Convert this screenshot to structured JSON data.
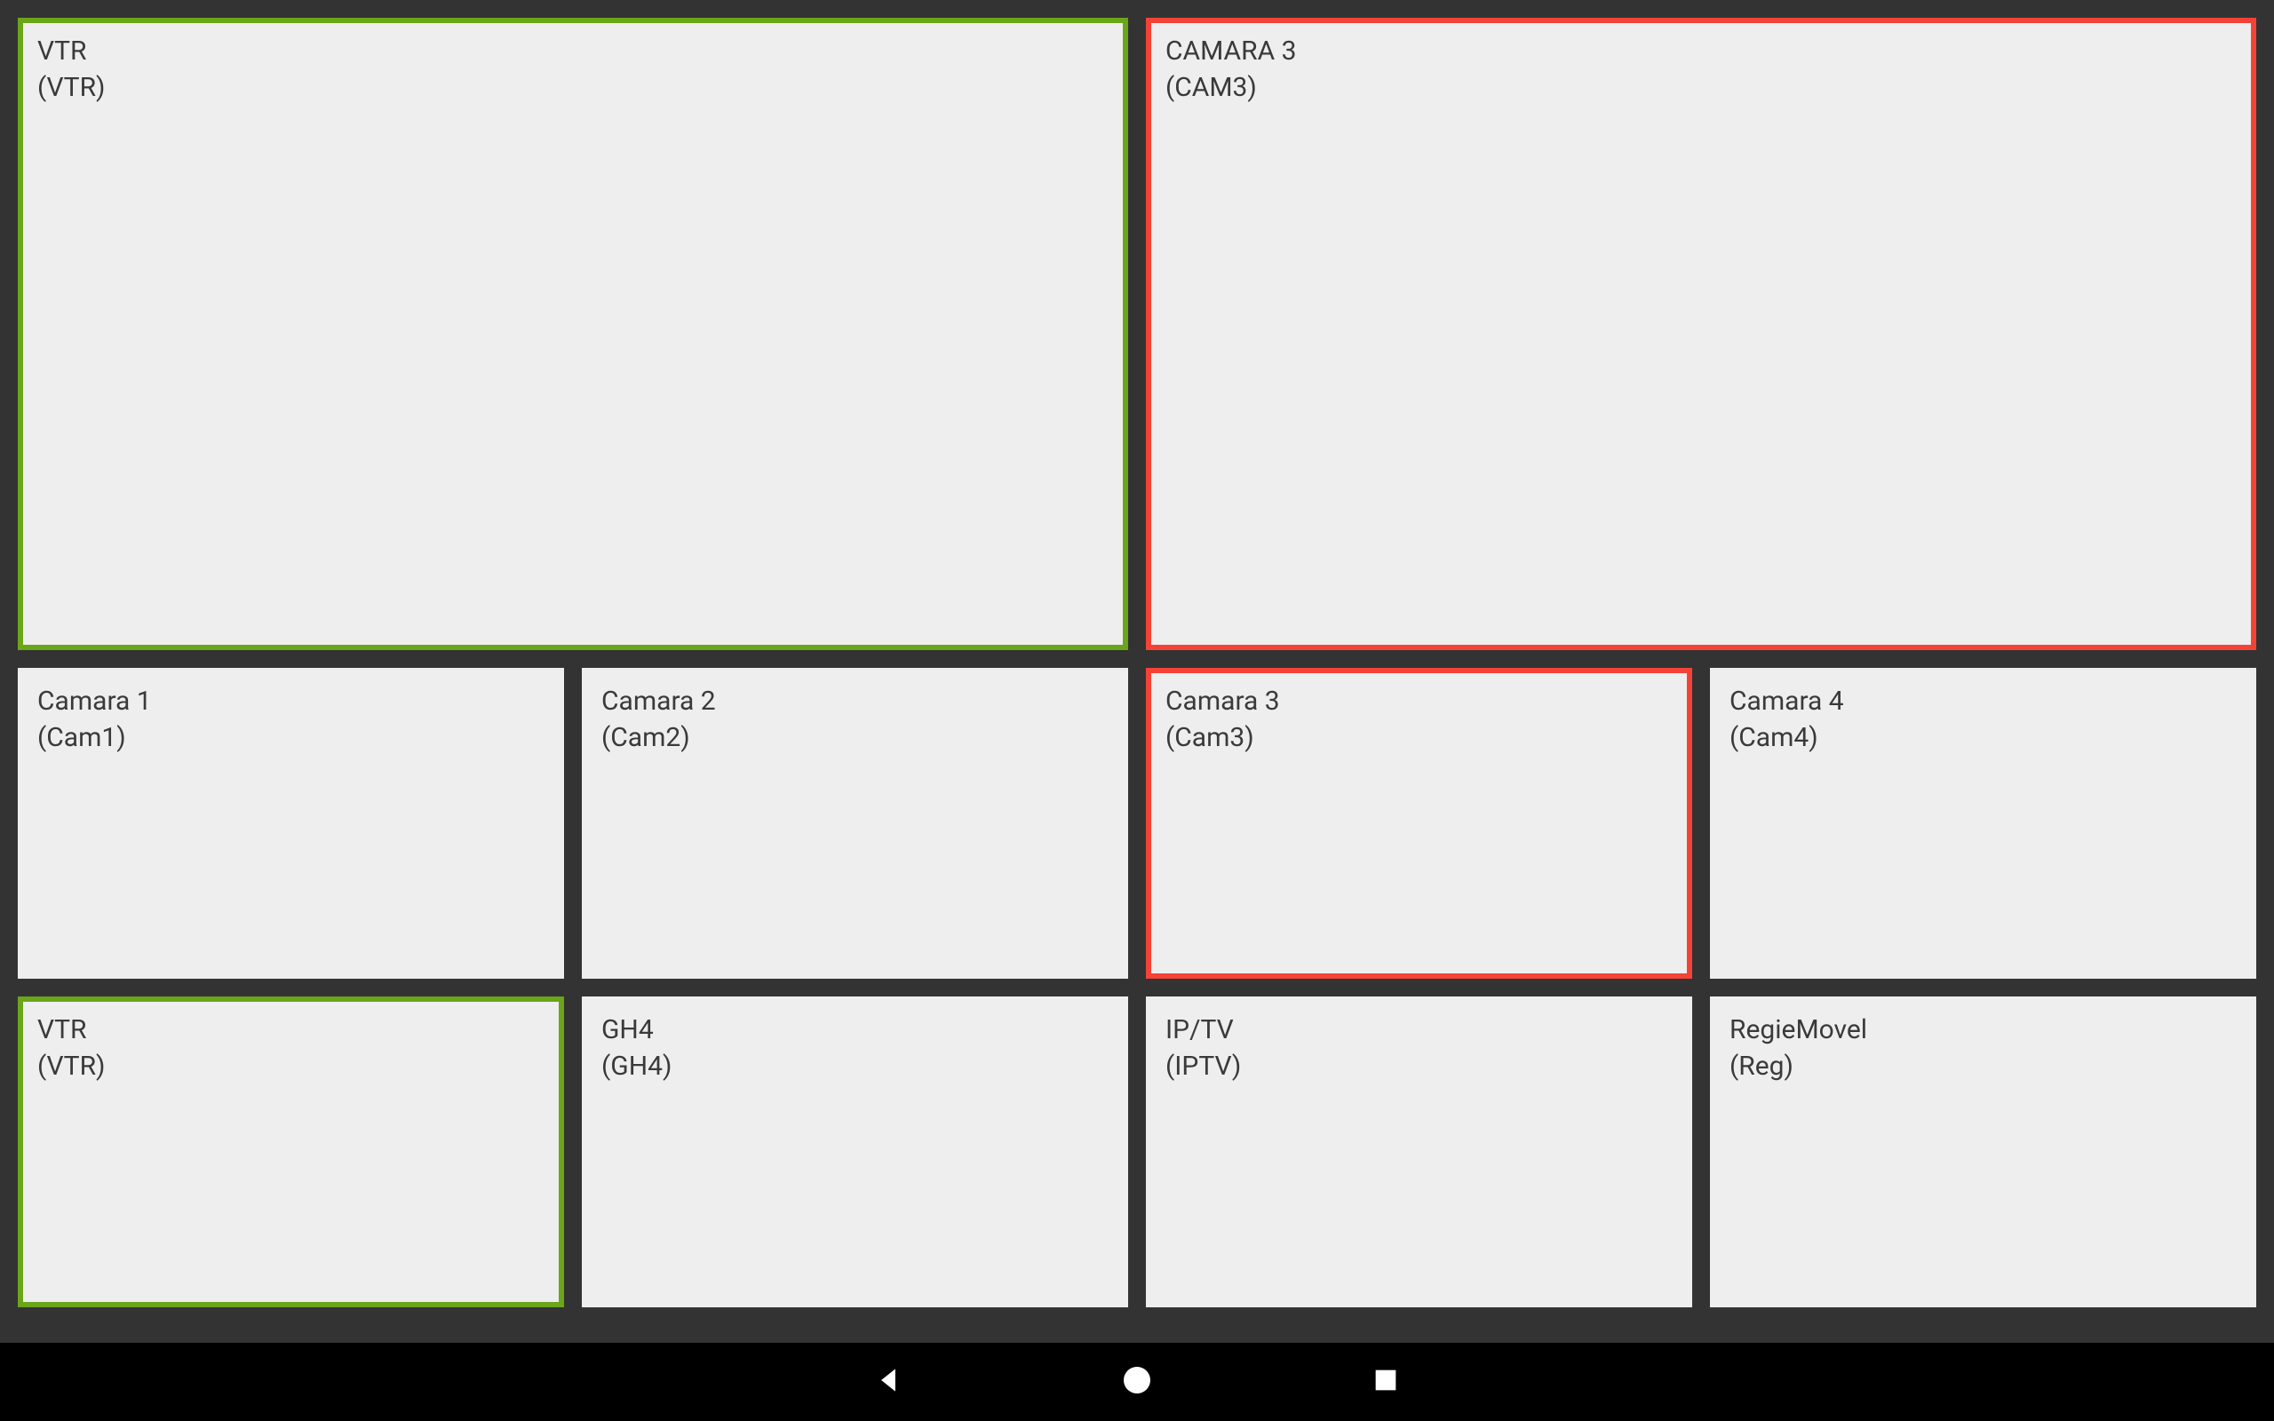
{
  "colors": {
    "background": "#333333",
    "panel": "#EEEEEE",
    "borderGreen": "#6AA51A",
    "borderRed": "#F44336",
    "navbar": "#000000"
  },
  "preview": {
    "left": {
      "title": "VTR",
      "sub": "(VTR)",
      "highlight": "green"
    },
    "right": {
      "title": "CAMARA 3",
      "sub": "(CAM3)",
      "highlight": "red"
    }
  },
  "sources": [
    {
      "title": "Camara 1",
      "sub": "(Cam1)",
      "highlight": "none"
    },
    {
      "title": "Camara 2",
      "sub": "(Cam2)",
      "highlight": "none"
    },
    {
      "title": "Camara 3",
      "sub": "(Cam3)",
      "highlight": "red"
    },
    {
      "title": "Camara 4",
      "sub": "(Cam4)",
      "highlight": "none"
    },
    {
      "title": "VTR",
      "sub": "(VTR)",
      "highlight": "green"
    },
    {
      "title": "GH4",
      "sub": "(GH4)",
      "highlight": "none"
    },
    {
      "title": "IP/TV",
      "sub": "(IPTV)",
      "highlight": "none"
    },
    {
      "title": "RegieMovel",
      "sub": "(Reg)",
      "highlight": "none"
    }
  ],
  "nav": {
    "back": "back",
    "home": "home",
    "recent": "recent"
  }
}
